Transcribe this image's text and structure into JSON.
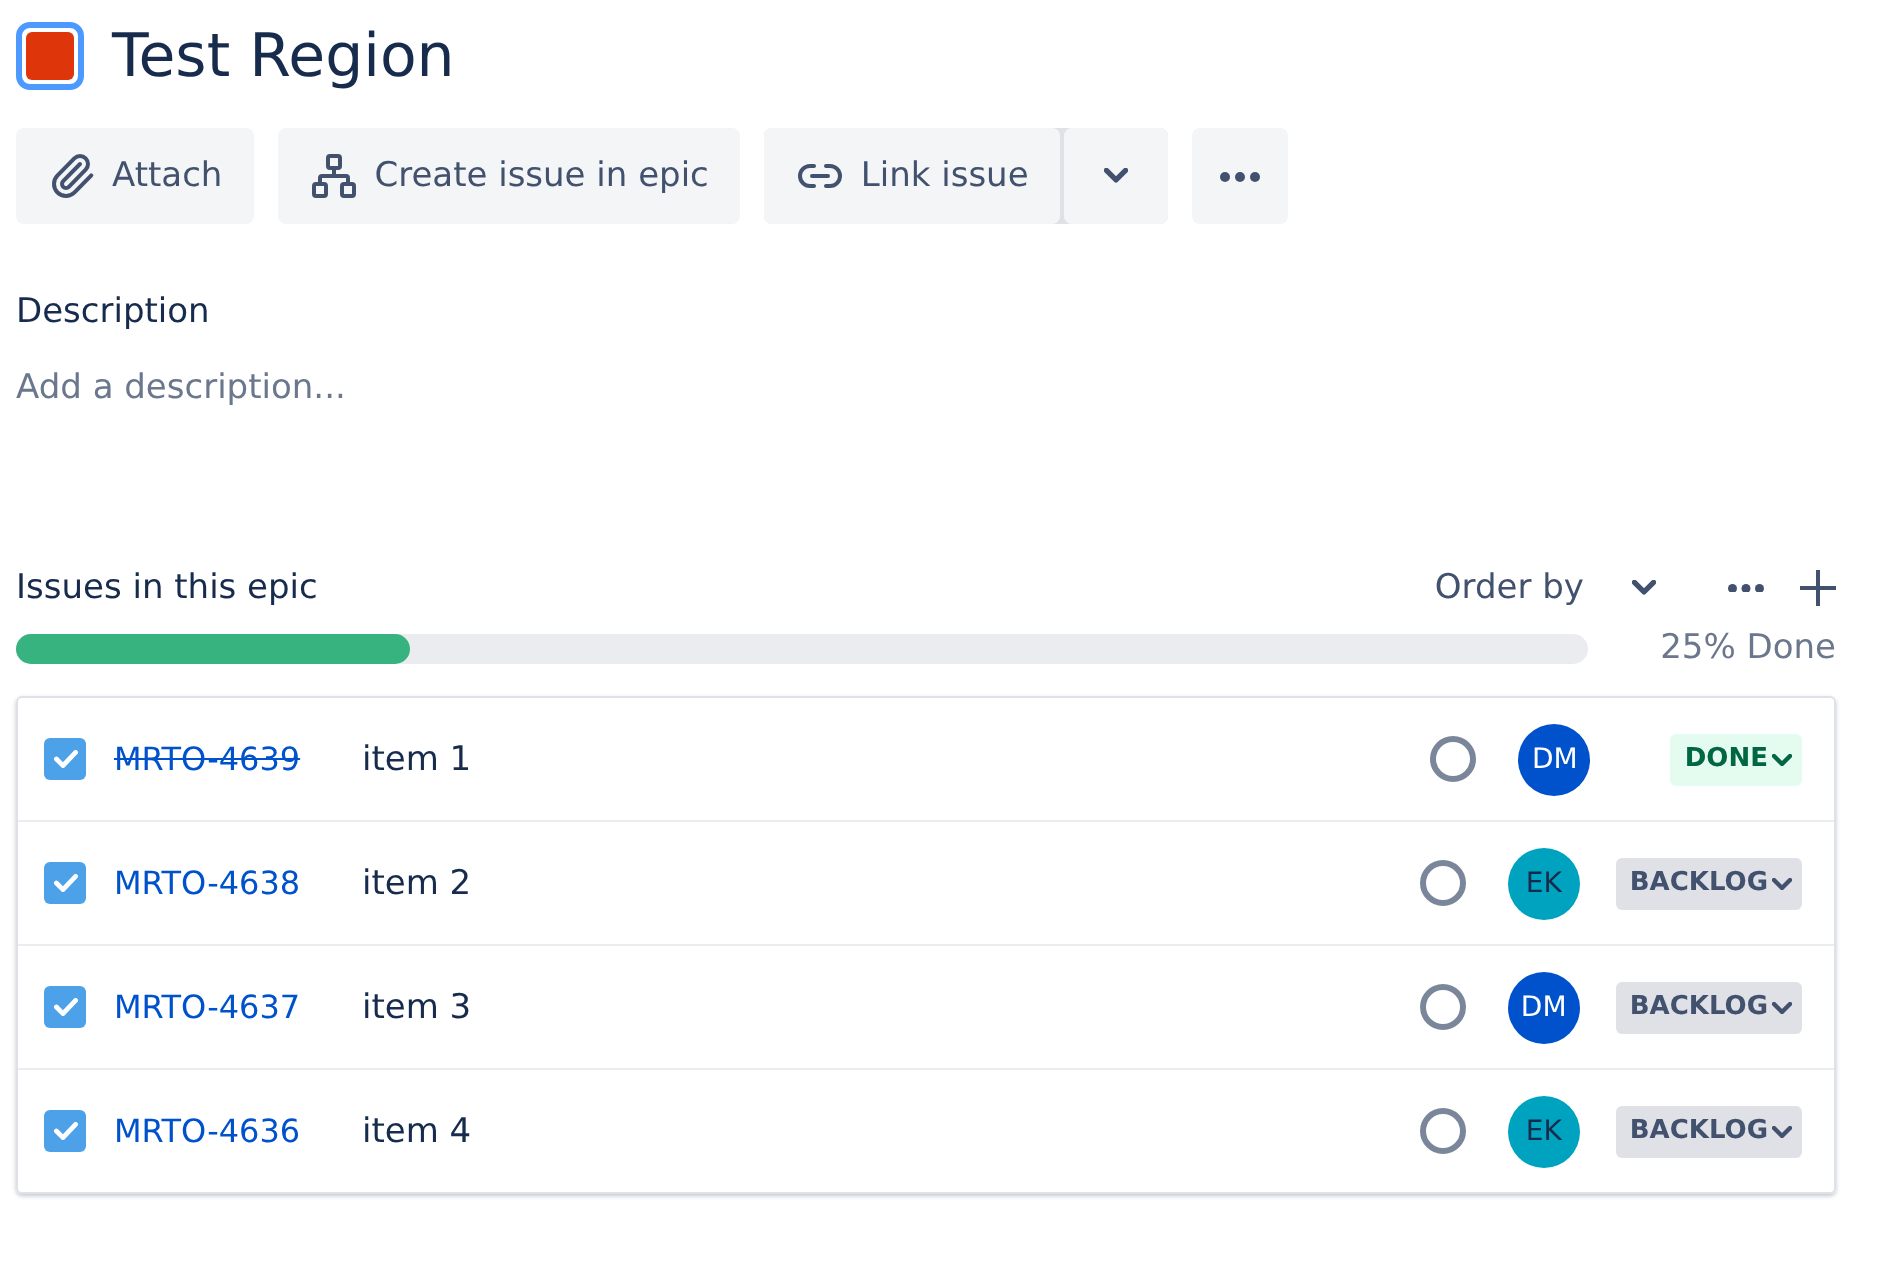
{
  "epic": {
    "title": "Test Region",
    "color": "#de350b"
  },
  "toolbar": [
    {
      "kind": "attach",
      "label": "Attach"
    },
    {
      "kind": "create",
      "label": "Create issue in epic"
    },
    {
      "kind": "link",
      "label": "Link issue"
    },
    {
      "kind": "more"
    }
  ],
  "description": {
    "heading": "Description",
    "placeholder": "Add a description..."
  },
  "issues": {
    "heading": "Issues in this epic",
    "order_by": "Order by",
    "level": 0.25,
    "progress_label": "25% Done",
    "rows": [
      {
        "key": "MRTO-4639",
        "summary": "item 1",
        "checked": true,
        "done": true,
        "assignee": "DM",
        "color": "#0052cc",
        "status": "DONE",
        "kind": "done"
      },
      {
        "key": "MRTO-4638",
        "summary": "item 2",
        "checked": true,
        "done": false,
        "assignee": "EK",
        "color": "#00a3bf",
        "status": "BACKLOG",
        "kind": "backlog"
      },
      {
        "key": "MRTO-4637",
        "summary": "item 3",
        "checked": true,
        "done": false,
        "assignee": "DM",
        "color": "#0052cc",
        "status": "BACKLOG",
        "kind": "backlog"
      },
      {
        "key": "MRTO-4636",
        "summary": "item 4",
        "checked": true,
        "done": false,
        "assignee": "EK",
        "color": "#00a3bf",
        "status": "BACKLOG",
        "kind": "backlog"
      }
    ]
  }
}
